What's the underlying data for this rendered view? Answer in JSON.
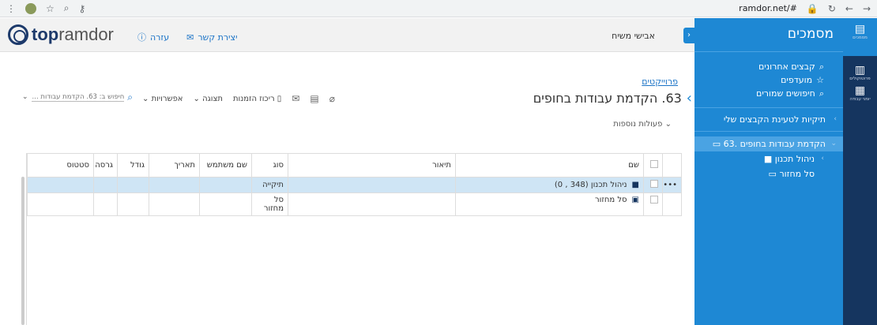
{
  "browser": {
    "url": "ramdor.net/#"
  },
  "header": {
    "logo_bold": "top",
    "logo_light": "ramdor",
    "help_label": "עזרה",
    "contact_label": "יצירת קשר",
    "user_name": "אבישי משיח"
  },
  "panel": {
    "title": "מסמכים",
    "links": [
      "קבצים אחרונים",
      "מועדפים",
      "חיפושים שמורים"
    ],
    "upload_folders": "תיקיות לטעינת הקבצים שלי",
    "tree": [
      "63. הקדמת עבודות בחופים",
      "ניהול תכנון",
      "סל מחזור"
    ]
  },
  "strip": {
    "items": [
      "מסמכים",
      "פרוטוקולים",
      "יומני עבודה"
    ]
  },
  "main": {
    "breadcrumb": "פרוייקטים",
    "title": "63. הקדמת עבודות בחופים",
    "more_actions": "פעולות נוספות",
    "toolbar": {
      "orders": "ריכוז הזמנות",
      "view": "תצוגה",
      "options": "אפשרויות"
    },
    "search_placeholder": "חיפוש ב: 63. הקדמת עבודות ..."
  },
  "table": {
    "headers": [
      "שם",
      "תיאור",
      "סוג",
      "שם משתמש",
      "תאריך",
      "גודל",
      "גרסה",
      "סטטוס"
    ],
    "rows": [
      {
        "name": "ניהול תכנון (348 , 0)",
        "type": "תיקייה"
      },
      {
        "name": "סל מחזור",
        "type": "סל מחזור"
      }
    ]
  }
}
